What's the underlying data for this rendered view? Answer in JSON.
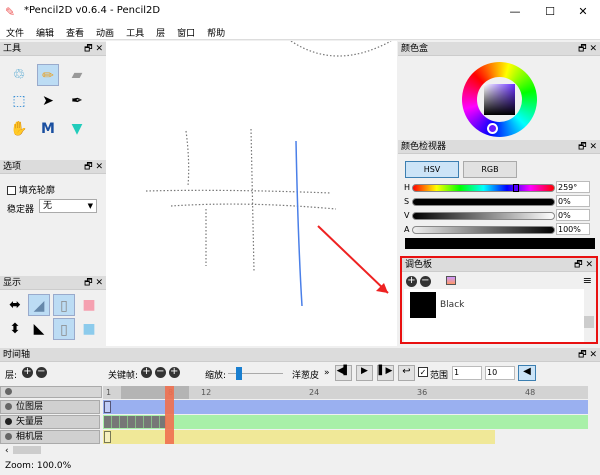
{
  "window": {
    "title": "*Pencil2D v0.6.4 - Pencil2D",
    "minimize": "—",
    "maximize": "☐",
    "close": "✕"
  },
  "menu": [
    "文件",
    "编辑",
    "查看",
    "动画",
    "工具",
    "层",
    "窗口",
    "帮助"
  ],
  "panels": {
    "tools": "工具",
    "options": "选项",
    "display": "显示",
    "color_box": "颜色盒",
    "color_inspector": "颜色检视器",
    "palette": "调色板",
    "timeline": "时间轴",
    "float": "🗗",
    "close": "✕"
  },
  "options": {
    "fill_contour": "填充轮廓",
    "stabilizer_label": "稳定器",
    "stabilizer_value": "无"
  },
  "color_inspector": {
    "tabs": [
      "HSV",
      "RGB"
    ],
    "active_tab": "HSV",
    "channels": [
      {
        "label": "H",
        "value": "259°"
      },
      {
        "label": "S",
        "value": "0%"
      },
      {
        "label": "V",
        "value": "0%"
      },
      {
        "label": "A",
        "value": "100%"
      }
    ],
    "current_color": "#000000",
    "hue": 259,
    "saturation": 0,
    "value": 0,
    "alpha": 100
  },
  "palette": {
    "colors": [
      {
        "name": "Black",
        "hex": "#000000"
      }
    ],
    "highlight_color": "#e81010"
  },
  "timeline": {
    "layer_label": "层:",
    "keyframe_label": "关键帧:",
    "zoom_label": "缩放:",
    "onion_label": "洋葱皮",
    "range_label": "范围",
    "range_checked": true,
    "range_start": "1",
    "range_end": "10",
    "ticks": [
      "1",
      "8",
      "12",
      "24",
      "36",
      "48"
    ],
    "current_frame": 8,
    "layers": [
      {
        "name": "位图层",
        "type": "bitmap",
        "color": "#9ab0f0"
      },
      {
        "name": "矢量层",
        "type": "vector",
        "color": "#a8f0a8"
      },
      {
        "name": "相机层",
        "type": "camera",
        "color": "#f0e898"
      }
    ]
  },
  "status": {
    "zoom": "Zoom: 100.0%"
  }
}
